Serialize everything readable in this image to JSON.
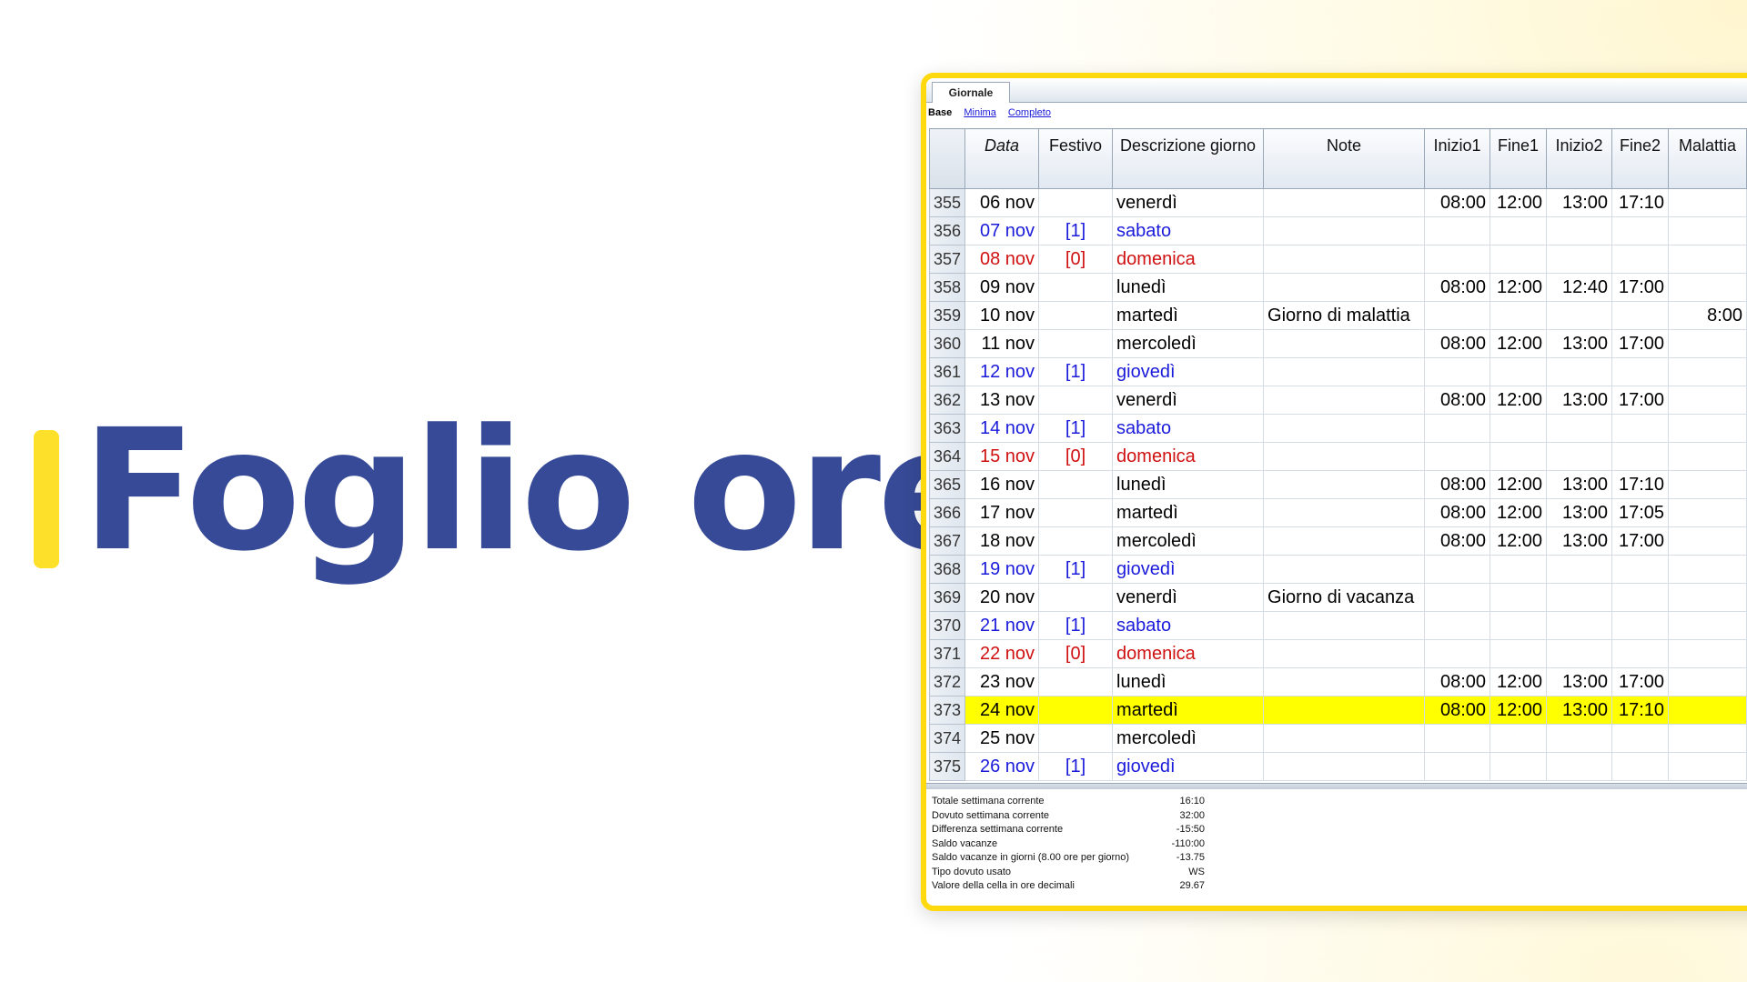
{
  "title": "Foglio ore",
  "colors": {
    "title": "#364a97",
    "accent": "#fde02a",
    "highlight": "#ffff00",
    "holiday_blue": "#1a1adb",
    "holiday_red": "#d01010"
  },
  "window": {
    "tab": "Giornale",
    "views": {
      "active": "Base",
      "minima": "Minima",
      "completo": "Completo"
    }
  },
  "table": {
    "headers": {
      "data": "Data",
      "festivo": "Festivo",
      "descrizione": "Descrizione giorno",
      "note": "Note",
      "inizio1": "Inizio1",
      "fine1": "Fine1",
      "inizio2": "Inizio2",
      "fine2": "Fine2",
      "malattia": "Malattia"
    },
    "rows": [
      {
        "n": "355",
        "data": "06 nov",
        "festivo": "",
        "descrizione": "venerdì",
        "note": "",
        "inizio1": "08:00",
        "fine1": "12:00",
        "inizio2": "13:00",
        "fine2": "17:10",
        "malattia": "",
        "style": "normal"
      },
      {
        "n": "356",
        "data": "07 nov",
        "festivo": "[1]",
        "descrizione": "sabato",
        "note": "",
        "inizio1": "",
        "fine1": "",
        "inizio2": "",
        "fine2": "",
        "malattia": "",
        "style": "blue"
      },
      {
        "n": "357",
        "data": "08 nov",
        "festivo": "[0]",
        "descrizione": "domenica",
        "note": "",
        "inizio1": "",
        "fine1": "",
        "inizio2": "",
        "fine2": "",
        "malattia": "",
        "style": "red"
      },
      {
        "n": "358",
        "data": "09 nov",
        "festivo": "",
        "descrizione": "lunedì",
        "note": "",
        "inizio1": "08:00",
        "fine1": "12:00",
        "inizio2": "12:40",
        "fine2": "17:00",
        "malattia": "",
        "style": "normal"
      },
      {
        "n": "359",
        "data": "10 nov",
        "festivo": "",
        "descrizione": "martedì",
        "note": "Giorno di malattia",
        "inizio1": "",
        "fine1": "",
        "inizio2": "",
        "fine2": "",
        "malattia": "8:00",
        "style": "normal"
      },
      {
        "n": "360",
        "data": "11 nov",
        "festivo": "",
        "descrizione": "mercoledì",
        "note": "",
        "inizio1": "08:00",
        "fine1": "12:00",
        "inizio2": "13:00",
        "fine2": "17:00",
        "malattia": "",
        "style": "normal"
      },
      {
        "n": "361",
        "data": "12 nov",
        "festivo": "[1]",
        "descrizione": "giovedì",
        "note": "",
        "inizio1": "",
        "fine1": "",
        "inizio2": "",
        "fine2": "",
        "malattia": "",
        "style": "blue"
      },
      {
        "n": "362",
        "data": "13 nov",
        "festivo": "",
        "descrizione": "venerdì",
        "note": "",
        "inizio1": "08:00",
        "fine1": "12:00",
        "inizio2": "13:00",
        "fine2": "17:00",
        "malattia": "",
        "style": "normal"
      },
      {
        "n": "363",
        "data": "14 nov",
        "festivo": "[1]",
        "descrizione": "sabato",
        "note": "",
        "inizio1": "",
        "fine1": "",
        "inizio2": "",
        "fine2": "",
        "malattia": "",
        "style": "blue"
      },
      {
        "n": "364",
        "data": "15 nov",
        "festivo": "[0]",
        "descrizione": "domenica",
        "note": "",
        "inizio1": "",
        "fine1": "",
        "inizio2": "",
        "fine2": "",
        "malattia": "",
        "style": "red"
      },
      {
        "n": "365",
        "data": "16 nov",
        "festivo": "",
        "descrizione": "lunedì",
        "note": "",
        "inizio1": "08:00",
        "fine1": "12:00",
        "inizio2": "13:00",
        "fine2": "17:10",
        "malattia": "",
        "style": "normal"
      },
      {
        "n": "366",
        "data": "17 nov",
        "festivo": "",
        "descrizione": "martedì",
        "note": "",
        "inizio1": "08:00",
        "fine1": "12:00",
        "inizio2": "13:00",
        "fine2": "17:05",
        "malattia": "",
        "style": "normal"
      },
      {
        "n": "367",
        "data": "18 nov",
        "festivo": "",
        "descrizione": "mercoledì",
        "note": "",
        "inizio1": "08:00",
        "fine1": "12:00",
        "inizio2": "13:00",
        "fine2": "17:00",
        "malattia": "",
        "style": "normal"
      },
      {
        "n": "368",
        "data": "19 nov",
        "festivo": "[1]",
        "descrizione": "giovedì",
        "note": "",
        "inizio1": "",
        "fine1": "",
        "inizio2": "",
        "fine2": "",
        "malattia": "",
        "style": "blue"
      },
      {
        "n": "369",
        "data": "20 nov",
        "festivo": "",
        "descrizione": "venerdì",
        "note": "Giorno di vacanza",
        "inizio1": "",
        "fine1": "",
        "inizio2": "",
        "fine2": "",
        "malattia": "",
        "style": "normal"
      },
      {
        "n": "370",
        "data": "21 nov",
        "festivo": "[1]",
        "descrizione": "sabato",
        "note": "",
        "inizio1": "",
        "fine1": "",
        "inizio2": "",
        "fine2": "",
        "malattia": "",
        "style": "blue"
      },
      {
        "n": "371",
        "data": "22 nov",
        "festivo": "[0]",
        "descrizione": "domenica",
        "note": "",
        "inizio1": "",
        "fine1": "",
        "inizio2": "",
        "fine2": "",
        "malattia": "",
        "style": "red"
      },
      {
        "n": "372",
        "data": "23 nov",
        "festivo": "",
        "descrizione": "lunedì",
        "note": "",
        "inizio1": "08:00",
        "fine1": "12:00",
        "inizio2": "13:00",
        "fine2": "17:00",
        "malattia": "",
        "style": "normal"
      },
      {
        "n": "373",
        "data": "24 nov",
        "festivo": "",
        "descrizione": "martedì",
        "note": "",
        "inizio1": "08:00",
        "fine1": "12:00",
        "inizio2": "13:00",
        "fine2": "17:10",
        "malattia": "",
        "style": "highlight"
      },
      {
        "n": "374",
        "data": "25 nov",
        "festivo": "",
        "descrizione": "mercoledì",
        "note": "",
        "inizio1": "",
        "fine1": "",
        "inizio2": "",
        "fine2": "",
        "malattia": "",
        "style": "normal"
      },
      {
        "n": "375",
        "data": "26 nov",
        "festivo": "[1]",
        "descrizione": "giovedì",
        "note": "",
        "inizio1": "",
        "fine1": "",
        "inizio2": "",
        "fine2": "",
        "malattia": "",
        "style": "blue"
      }
    ]
  },
  "summary": [
    {
      "label": "Totale settimana corrente",
      "value": "16:10"
    },
    {
      "label": "Dovuto settimana corrente",
      "value": "32:00"
    },
    {
      "label": "Differenza settimana corrente",
      "value": "-15:50"
    },
    {
      "label": "Saldo vacanze",
      "value": "-110:00"
    },
    {
      "label": "Saldo vacanze in giorni (8.00 ore per giorno)",
      "value": "-13.75"
    },
    {
      "label": "Tipo dovuto usato",
      "value": "WS"
    },
    {
      "label": "Valore della cella in ore decimali",
      "value": "29.67"
    }
  ]
}
